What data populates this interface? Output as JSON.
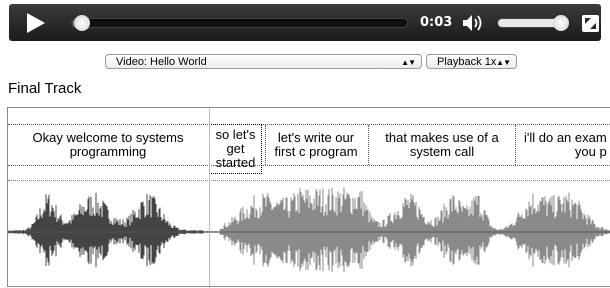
{
  "player": {
    "time": "0:03",
    "progress_fraction": 0.03,
    "volume_fraction": 0.95
  },
  "selects": {
    "video": "Video: Hello World",
    "playback": "Playback 1x"
  },
  "track": {
    "title": "Final Track",
    "captions": [
      {
        "lines": [
          "Okay welcome to systems",
          "programming"
        ]
      },
      {
        "lines": [
          "so let's",
          "get",
          "started"
        ]
      },
      {
        "lines": [
          "let's write our",
          "first c program"
        ]
      },
      {
        "lines": [
          "that makes use of a",
          "system call"
        ]
      },
      {
        "lines": [
          "i'll do an exam",
          "you p"
        ]
      }
    ]
  },
  "colors": {
    "waveform_played": "#444444",
    "waveform_unplayed": "#8a8a8a"
  }
}
